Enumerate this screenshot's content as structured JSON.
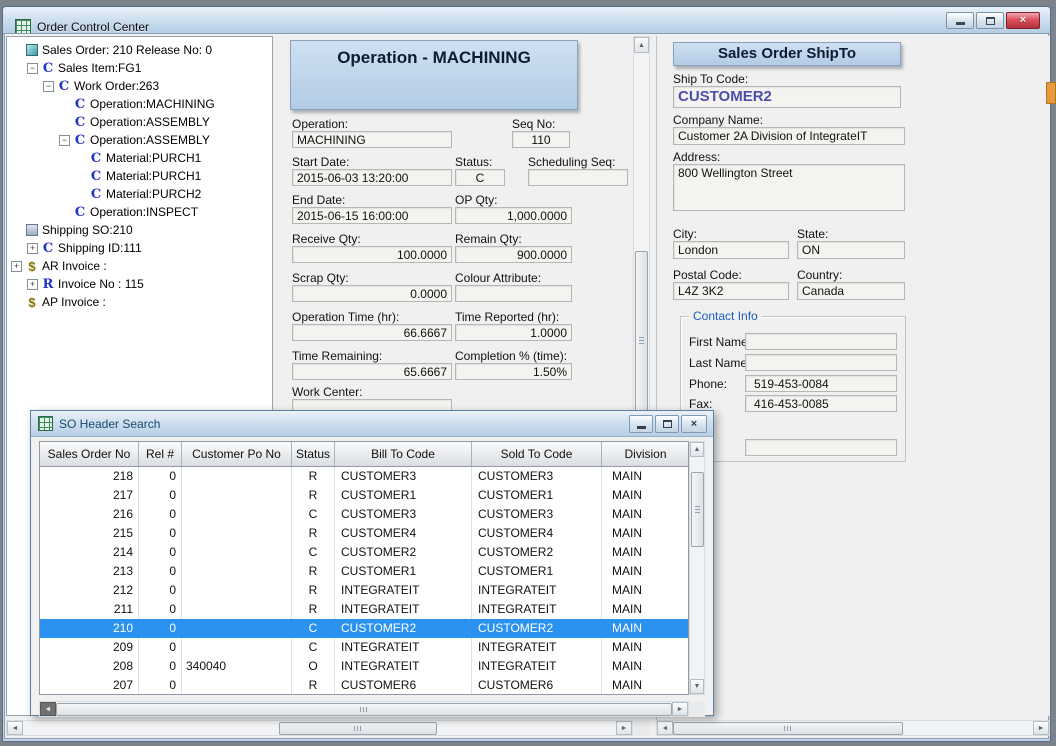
{
  "window": {
    "title": "Order Control Center"
  },
  "icons": {
    "c": "C",
    "r": "R",
    "dollar": "$",
    "order": "",
    "ship": ""
  },
  "tree": {
    "items": [
      {
        "label": "Sales Order: 210 Release No: 0",
        "level": 0,
        "box": null,
        "icon": "order"
      },
      {
        "label": "Sales Item:FG1",
        "level": 1,
        "box": "minus",
        "icon": "c"
      },
      {
        "label": "Work Order:263",
        "level": 2,
        "box": "minus",
        "icon": "c"
      },
      {
        "label": "Operation:MACHINING",
        "level": 3,
        "box": null,
        "icon": "c"
      },
      {
        "label": "Operation:ASSEMBLY",
        "level": 3,
        "box": null,
        "icon": "c"
      },
      {
        "label": "Operation:ASSEMBLY",
        "level": 3,
        "box": "minus",
        "icon": "c"
      },
      {
        "label": "Material:PURCH1",
        "level": 4,
        "box": null,
        "icon": "c"
      },
      {
        "label": "Material:PURCH1",
        "level": 4,
        "box": null,
        "icon": "c"
      },
      {
        "label": "Material:PURCH2",
        "level": 4,
        "box": null,
        "icon": "c"
      },
      {
        "label": "Operation:INSPECT",
        "level": 3,
        "box": null,
        "icon": "c"
      },
      {
        "label": "Shipping SO:210",
        "level": 0,
        "box": null,
        "icon": "ship"
      },
      {
        "label": "Shipping ID:111",
        "level": 1,
        "box": "plus",
        "icon": "c"
      },
      {
        "label": "AR Invoice :",
        "level": 0,
        "box": "plus",
        "icon": "dollar"
      },
      {
        "label": "Invoice No : 115",
        "level": 1,
        "box": "plus",
        "icon": "r"
      },
      {
        "label": "AP Invoice :",
        "level": 0,
        "box": null,
        "icon": "dollar"
      }
    ]
  },
  "operation_panel": {
    "title": "Operation - MACHINING",
    "fields": {
      "operation": {
        "label": "Operation:",
        "value": "MACHINING"
      },
      "seq_no": {
        "label": "Seq No:",
        "value": "110"
      },
      "start_date": {
        "label": "Start Date:",
        "value": "2015-06-03 13:20:00"
      },
      "status": {
        "label": "Status:",
        "value": "C"
      },
      "scheduling_seq": {
        "label": "Scheduling Seq:",
        "value": ""
      },
      "end_date": {
        "label": "End Date:",
        "value": "2015-06-15 16:00:00"
      },
      "op_qty": {
        "label": "OP Qty:",
        "value": "1,000.0000"
      },
      "receive_qty": {
        "label": "Receive Qty:",
        "value": "100.0000"
      },
      "remain_qty": {
        "label": "Remain Qty:",
        "value": "900.0000"
      },
      "scrap_qty": {
        "label": "Scrap Qty:",
        "value": "0.0000"
      },
      "colour_attribute": {
        "label": "Colour Attribute:",
        "value": ""
      },
      "operation_time": {
        "label": "Operation Time (hr):",
        "value": "66.6667"
      },
      "time_reported": {
        "label": "Time Reported (hr):",
        "value": "1.0000"
      },
      "time_remaining": {
        "label": "Time Remaining:",
        "value": "65.6667"
      },
      "completion_pct": {
        "label": "Completion % (time):",
        "value": "1.50%"
      },
      "work_center": {
        "label": "Work Center:",
        "value": ""
      }
    }
  },
  "shipto_panel": {
    "title": "Sales Order ShipTo",
    "fields": {
      "ship_to_code": {
        "label": "Ship To Code:",
        "value": "CUSTOMER2"
      },
      "company_name": {
        "label": "Company Name:",
        "value": "Customer 2A Division of IntegrateIT"
      },
      "address": {
        "label": "Address:",
        "value": "800 Wellington Street"
      },
      "city": {
        "label": "City:",
        "value": "London"
      },
      "state": {
        "label": "State:",
        "value": "ON"
      },
      "postal_code": {
        "label": "Postal Code:",
        "value": "L4Z 3K2"
      },
      "country": {
        "label": "Country:",
        "value": "Canada"
      }
    },
    "contact": {
      "title": "Contact Info",
      "fields": {
        "first_name": {
          "label": "First Name:",
          "value": ""
        },
        "last_name": {
          "label": "Last Name:",
          "value": ""
        },
        "phone": {
          "label": "Phone:",
          "value": "519-453-0084"
        },
        "fax": {
          "label": "Fax:",
          "value": "416-453-0085"
        },
        "extra": {
          "label": "",
          "value": ""
        }
      }
    }
  },
  "so_search": {
    "title": "SO Header Search",
    "columns": [
      "Sales Order No",
      "Rel #",
      "Customer Po No",
      "Status",
      "Bill To Code",
      "Sold To Code",
      "Division"
    ],
    "rows": [
      {
        "selected": false,
        "cells": [
          "218",
          "0",
          "",
          "R",
          "CUSTOMER3",
          "CUSTOMER3",
          "MAIN"
        ]
      },
      {
        "selected": false,
        "cells": [
          "217",
          "0",
          "",
          "R",
          "CUSTOMER1",
          "CUSTOMER1",
          "MAIN"
        ]
      },
      {
        "selected": false,
        "cells": [
          "216",
          "0",
          "",
          "C",
          "CUSTOMER3",
          "CUSTOMER3",
          "MAIN"
        ]
      },
      {
        "selected": false,
        "cells": [
          "215",
          "0",
          "",
          "R",
          "CUSTOMER4",
          "CUSTOMER4",
          "MAIN"
        ]
      },
      {
        "selected": false,
        "cells": [
          "214",
          "0",
          "",
          "C",
          "CUSTOMER2",
          "CUSTOMER2",
          "MAIN"
        ]
      },
      {
        "selected": false,
        "cells": [
          "213",
          "0",
          "",
          "R",
          "CUSTOMER1",
          "CUSTOMER1",
          "MAIN"
        ]
      },
      {
        "selected": false,
        "cells": [
          "212",
          "0",
          "",
          "R",
          "INTEGRATEIT",
          "INTEGRATEIT",
          "MAIN"
        ]
      },
      {
        "selected": false,
        "cells": [
          "211",
          "0",
          "",
          "R",
          "INTEGRATEIT",
          "INTEGRATEIT",
          "MAIN"
        ]
      },
      {
        "selected": true,
        "cells": [
          "210",
          "0",
          "",
          "C",
          "CUSTOMER2",
          "CUSTOMER2",
          "MAIN"
        ]
      },
      {
        "selected": false,
        "cells": [
          "209",
          "0",
          "",
          "C",
          "INTEGRATEIT",
          "INTEGRATEIT",
          "MAIN"
        ]
      },
      {
        "selected": false,
        "cells": [
          "208",
          "0",
          "340040",
          "O",
          "INTEGRATEIT",
          "INTEGRATEIT",
          "MAIN"
        ]
      },
      {
        "selected": false,
        "cells": [
          "207",
          "0",
          "",
          "R",
          "CUSTOMER6",
          "CUSTOMER6",
          "MAIN"
        ]
      }
    ]
  },
  "colors": {
    "selection_blue": "#2b92f0",
    "panel_header_blue": "#b2cbe5",
    "shipto_value_blue": "#4d4dac",
    "contact_title_blue": "#1b5cbe",
    "close_button_red": "#c83c48",
    "edge_artifact_orange": "#e79a3c"
  }
}
